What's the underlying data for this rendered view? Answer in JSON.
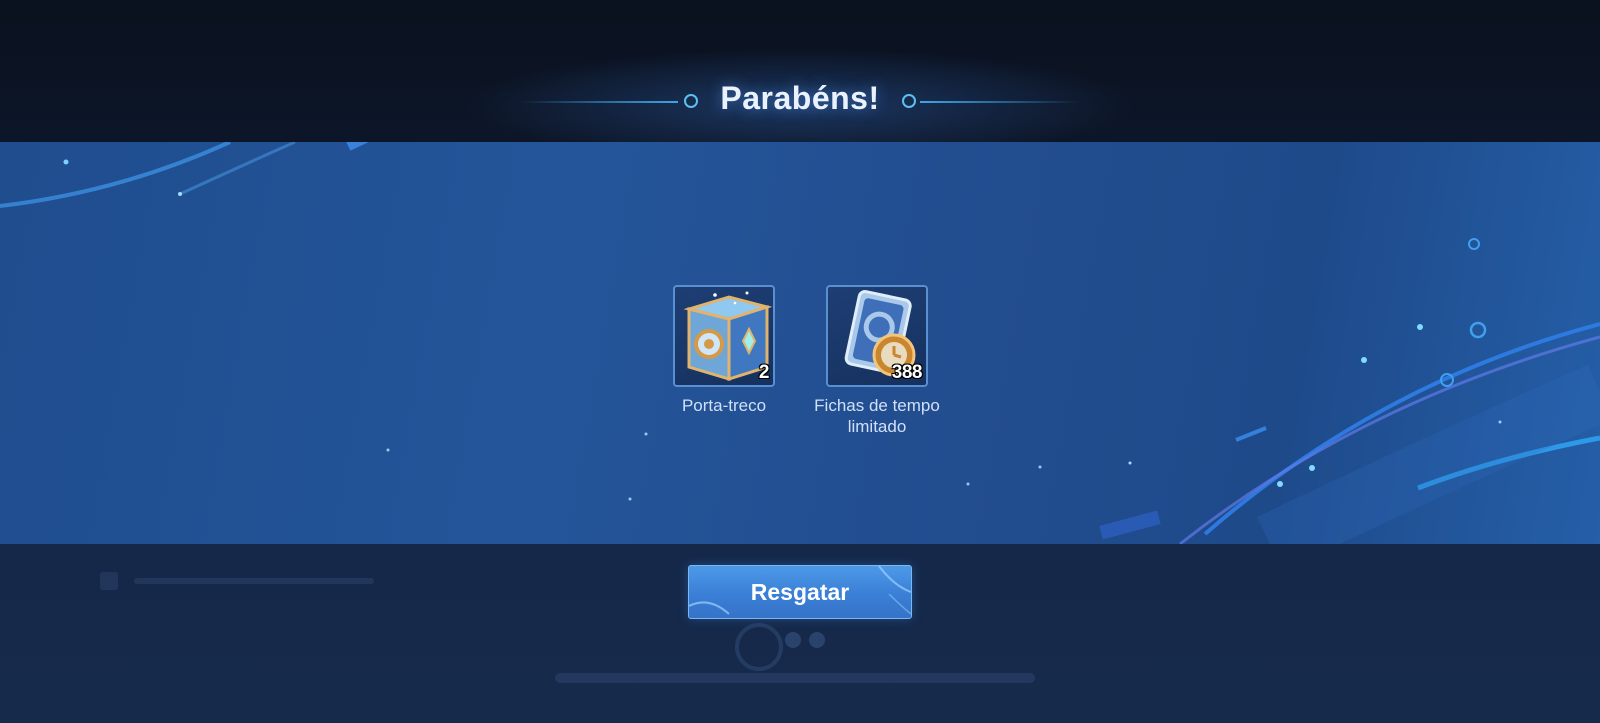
{
  "popup": {
    "title": "Parabéns!"
  },
  "rewards": [
    {
      "name": "Porta-treco",
      "quantity": "2",
      "icon": "treasure-chest-icon"
    },
    {
      "name": "Fichas de tempo limitado",
      "quantity": "388",
      "icon": "limited-time-token-icon"
    }
  ],
  "actions": {
    "claim_label": "Resgatar"
  },
  "colors": {
    "band": "#24559a",
    "button": "#3a7fd6",
    "accent_line": "#3da6e6"
  }
}
